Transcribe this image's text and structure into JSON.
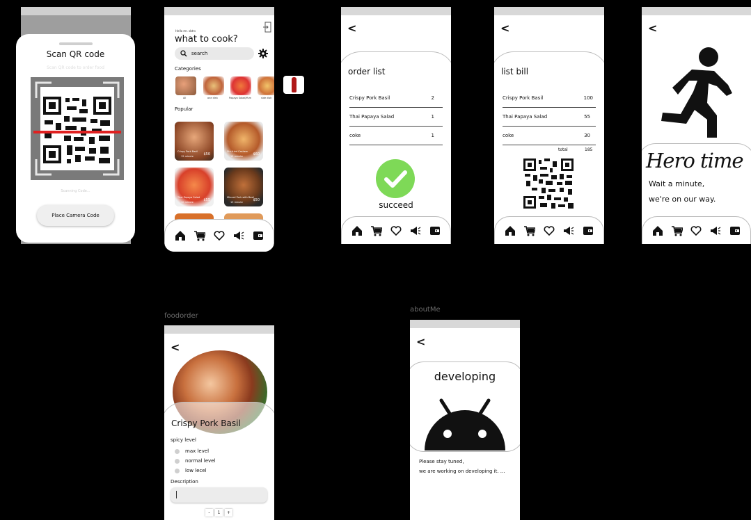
{
  "scan_screen": {
    "title": "Scan QR code",
    "subtitle": "Scan QR code to order food",
    "scanning_text": "Scanning Code...",
    "button_label": "Place Camera Code"
  },
  "home_screen": {
    "greeting": "Hello mr. sbtrs",
    "title": "what to cook?",
    "search_placeholder": "search",
    "categories_heading": "Categories",
    "categories": [
      "All",
      "one dish",
      "Papaya Salad/Yum",
      "side dish"
    ],
    "popular_heading": "Popular",
    "foods": [
      {
        "name": "Crispy Pork Basil",
        "time": "15 minute",
        "price": "$50"
      },
      {
        "name": "Stir-fried Cashew",
        "time": "15 minute",
        "price": "$60"
      },
      {
        "name": "Thai Papaya Salad",
        "time": "10 minute",
        "price": "$55"
      },
      {
        "name": "Minced Pork with Basil",
        "time": "15 minute",
        "price": "$50"
      }
    ]
  },
  "order_screen": {
    "title": "order list",
    "items": [
      {
        "name": "Crispy Pork Basil",
        "qty": "2"
      },
      {
        "name": "Thai Papaya Salad",
        "qty": "1"
      },
      {
        "name": "coke",
        "qty": "1"
      }
    ],
    "status": "succeed"
  },
  "bill_screen": {
    "title": "list bill",
    "items": [
      {
        "name": "Crispy Pork Basil",
        "price": "100"
      },
      {
        "name": "Thai Papaya Salad",
        "price": "55"
      },
      {
        "name": "coke",
        "price": "30"
      }
    ],
    "total_label": "total",
    "total_value": "185"
  },
  "hero_screen": {
    "script_title": "Hero time",
    "line1": "Wait a minute,",
    "line2": "we're on our way."
  },
  "foodorder_screen": {
    "frame_label": "foodorder",
    "dish": "Crispy Pork Basil",
    "spicy_heading": "spicy level",
    "levels": [
      "max level",
      "normal  level",
      "low lecel"
    ],
    "description_heading": "Description",
    "stepper": {
      "minus": "-",
      "value": "1",
      "plus": "+"
    }
  },
  "about_screen": {
    "frame_label": "aboutMe",
    "title": "developing",
    "line1": "Please stay tuned,",
    "line2": "we are working on developing it. ..."
  },
  "nav_icons": [
    "home-icon",
    "cart-icon",
    "heart-icon",
    "megaphone-icon",
    "wallet-icon"
  ],
  "colors": {
    "success": "#7ed957",
    "scan_line": "#e02020",
    "frame_border": "#bdbdbd"
  }
}
